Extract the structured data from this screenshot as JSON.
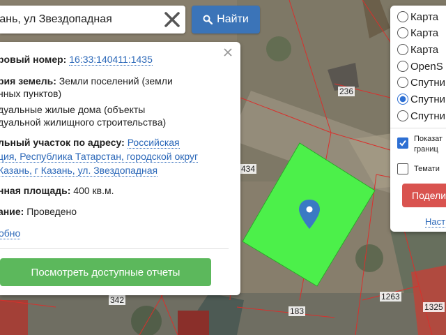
{
  "search": {
    "value": "зань, ул Звездопадная",
    "find_label": "Найти"
  },
  "info": {
    "cadastral_label": "ровый номер:",
    "cadastral_value": "16:33:140411:1435",
    "category_label": "рия земель:",
    "category_value_1": "Земли поселений (земли",
    "category_value_2": "нных пунктов)",
    "use_1": "дуальные жилые дома (объекты",
    "use_2": "дуальной жилищного строительства)",
    "address_label": "льный участок по адресу:",
    "address_1": "Российская",
    "address_2": "ция, Республика Татарстан, городской округ",
    "address_3": "Казань, г Казань, ул. Звездопадная",
    "area_label": "нная площадь:",
    "area_value": "400 кв.м.",
    "survey_label": "ание:",
    "survey_value": "Проведено",
    "more_link": "обно",
    "reports_button": "Посмотреть доступные отчеты"
  },
  "layers": {
    "options": [
      {
        "label": "Карта",
        "selected": false
      },
      {
        "label": "Карта",
        "selected": false
      },
      {
        "label": "Карта",
        "selected": false
      },
      {
        "label": "OpenS",
        "selected": false
      },
      {
        "label": "Спутни",
        "selected": false
      },
      {
        "label": "Спутни",
        "selected": true
      },
      {
        "label": "Спутни",
        "selected": false
      }
    ],
    "show_borders_1": "Показат",
    "show_borders_2": "границ",
    "show_borders_checked": true,
    "thematic": "Темати",
    "thematic_checked": false,
    "share_button": "Подели",
    "settings_link": "Наст"
  },
  "map": {
    "parcel_labels": [
      "236",
      "434",
      "342",
      "183",
      "1263",
      "1325"
    ],
    "parcel_color": "#4cf04a"
  }
}
